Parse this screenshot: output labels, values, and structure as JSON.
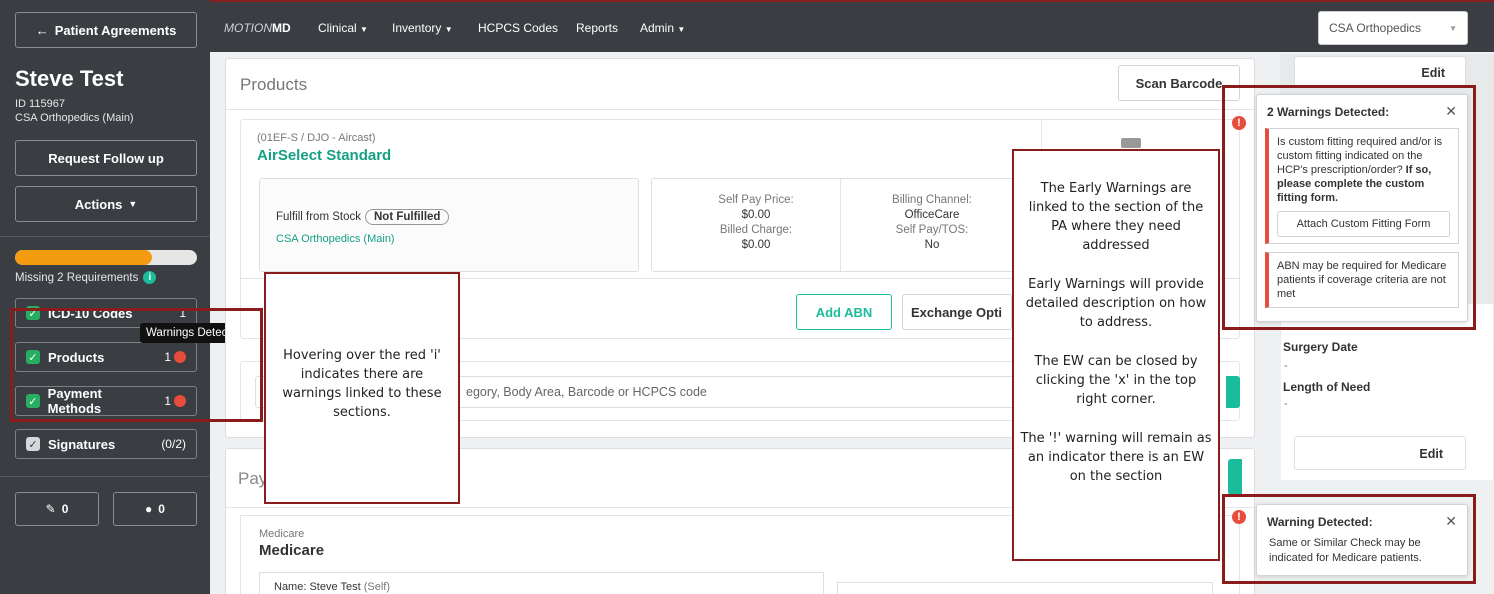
{
  "sidebar": {
    "back_button": "Patient Agreements",
    "patient_name": "Steve Test",
    "patient_id": "ID 115967",
    "patient_location": "CSA Orthopedics (Main)",
    "request_follow_up": "Request Follow up",
    "actions": "Actions",
    "progress_fraction": 0.75,
    "missing_requirements": "Missing 2 Requirements",
    "sections": [
      {
        "label": "ICD-10 Codes",
        "count": "1",
        "warning": false
      },
      {
        "label": "Products",
        "count": "1",
        "warning": true
      },
      {
        "label": "Payment Methods",
        "count": "1",
        "warning": true
      },
      {
        "label": "Signatures",
        "count": "(0/2)",
        "warning": false
      }
    ],
    "tooltip": "Warnings Detected",
    "attachments_count": "0",
    "comments_count": "0"
  },
  "topnav": {
    "brand_prefix": "MOTION",
    "brand_suffix": "MD",
    "items": [
      "Clinical",
      "Inventory",
      "HCPCS Codes",
      "Reports",
      "Admin"
    ],
    "practice": "CSA Orthopedics"
  },
  "products": {
    "title": "Products",
    "scan_barcode": "Scan Barcode",
    "item_code": "(01EF-S / DJO - Aircast)",
    "item_name": "AirSelect Standard",
    "fulfill_label": "Fulfill from Stock",
    "fulfill_status": "Not Fulfilled",
    "fulfill_location": "CSA Orthopedics (Main)",
    "self_pay_price_label": "Self Pay Price:",
    "self_pay_price": "$0.00",
    "billed_charge_label": "Billed Charge:",
    "billed_charge": "$0.00",
    "billing_channel_label": "Billing Channel:",
    "billing_channel": "OfficeCare",
    "self_pay_tos_label": "Self Pay/TOS:",
    "self_pay_tos": "No",
    "add_abn": "Add ABN",
    "exchange_options": "Exchange Opti",
    "search_placeholder_fragment": "egory, Body Area, Barcode or HCPCS code"
  },
  "payment": {
    "title_fragment": "Pay",
    "payer_small": "Medicare",
    "payer_name": "Medicare",
    "name_label": "Name:",
    "name_value": "Steve Test",
    "name_rel": "(Self)"
  },
  "right": {
    "edit_top": "Edit",
    "surgery_date_label": "Surgery Date",
    "surgery_date_value": "-",
    "length_of_need_label": "Length of Need",
    "length_of_need_value": "-",
    "edit_bottom": "Edit"
  },
  "warnings": {
    "first": {
      "title": "2 Warnings Detected:",
      "item1_text": "Is custom fitting required and/or is custom fitting indicated on the HCP's prescription/order?",
      "item1_bold": "If so, please complete the custom fitting form.",
      "item1_action": "Attach Custom Fitting Form",
      "item2_text": "ABN may be required for Medicare patients if coverage criteria are not met"
    },
    "second": {
      "title": "Warning Detected:",
      "item1_text": "Same or Similar Check may be indicated for Medicare patients."
    }
  },
  "callouts": {
    "hover_note": "Hovering over the red 'i' indicates there are warnings linked to these sections.",
    "ew_p1": "The Early Warnings are linked to the section of the PA where they need addressed",
    "ew_p2": "Early Warnings will provide detailed description on how to address.",
    "ew_p3": "The EW can be closed by clicking the 'x' in the top right corner.",
    "ew_p4": "The '!' warning will remain as an indicator there is an EW on the section"
  },
  "colors": {
    "sidebar_bg": "#3a3d42",
    "accent_teal": "#1bbc9b",
    "warning_red": "#e74c3c",
    "callout_border": "#8b1c1c",
    "progress": "#f39c12"
  }
}
